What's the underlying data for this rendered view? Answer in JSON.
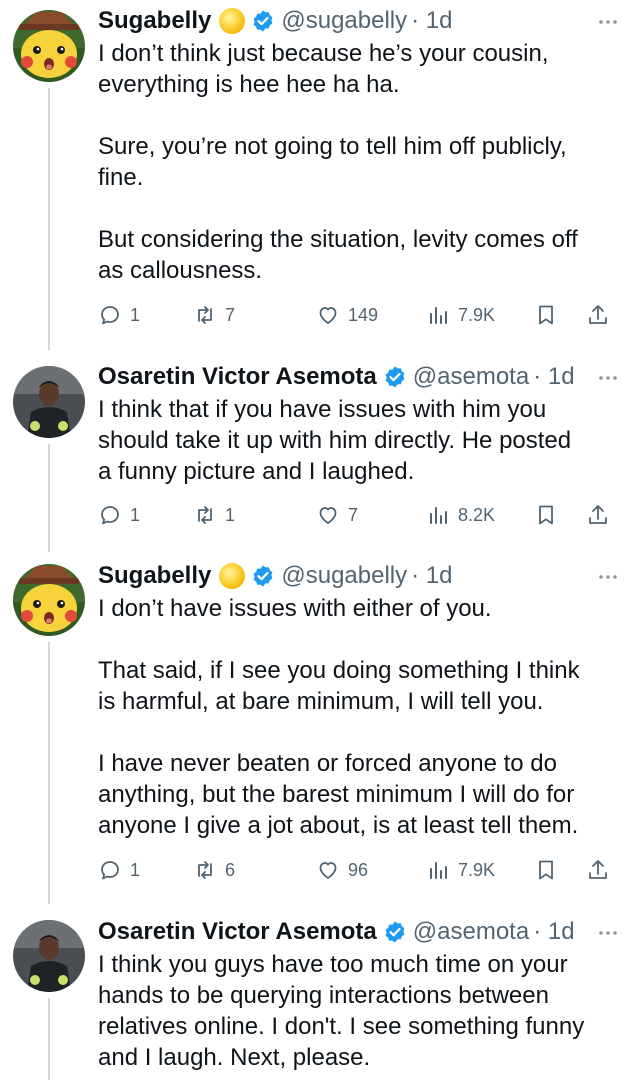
{
  "tweets": [
    {
      "avatar": "pikachu-avatar",
      "name": "Sugabelly",
      "name_emoji": "coin-emoji",
      "verified": true,
      "handle": "@sugabelly",
      "time": "· 1d",
      "text": "I don’t think just because he’s your cousin,\neverything is hee hee ha ha.\n\nSure, you’re not going to tell him off publicly,\nfine.\n\nBut considering the situation, levity comes off\nas callousness.",
      "replies": "1",
      "retweets": "7",
      "likes": "149",
      "views": "7.9K"
    },
    {
      "avatar": "goalkeeper-avatar",
      "name": "Osaretin Victor Asemota",
      "verified": true,
      "handle": "@asemota",
      "time": "· 1d",
      "text": "I think that if you have issues with him you\nshould take it up with him directly. He posted\na funny picture and I laughed.",
      "replies": "1",
      "retweets": "1",
      "likes": "7",
      "views": "8.2K"
    },
    {
      "avatar": "pikachu-avatar",
      "name": "Sugabelly",
      "name_emoji": "coin-emoji",
      "verified": true,
      "handle": "@sugabelly",
      "time": "· 1d",
      "text": "I don’t have issues with either of you.\n\nThat said, if I see you doing something I think\nis harmful, at bare minimum, I will tell you.\n\nI have never beaten or forced anyone to do\nanything, but the barest minimum I will do for\nanyone I give a jot about, is at least tell them.",
      "replies": "1",
      "retweets": "6",
      "likes": "96",
      "views": "7.9K"
    },
    {
      "avatar": "goalkeeper-avatar",
      "name": "Osaretin Victor Asemota",
      "verified": true,
      "handle": "@asemota",
      "time": "· 1d",
      "text": "I think you guys have too much time on your\nhands to be querying interactions between\nrelatives online. I don't. I see something funny\nand I laugh. Next, please."
    }
  ],
  "colors": {
    "text": "#0f1419",
    "secondary": "#536471",
    "verified": "#1d9bf0",
    "thread_line": "#cfd9de"
  }
}
